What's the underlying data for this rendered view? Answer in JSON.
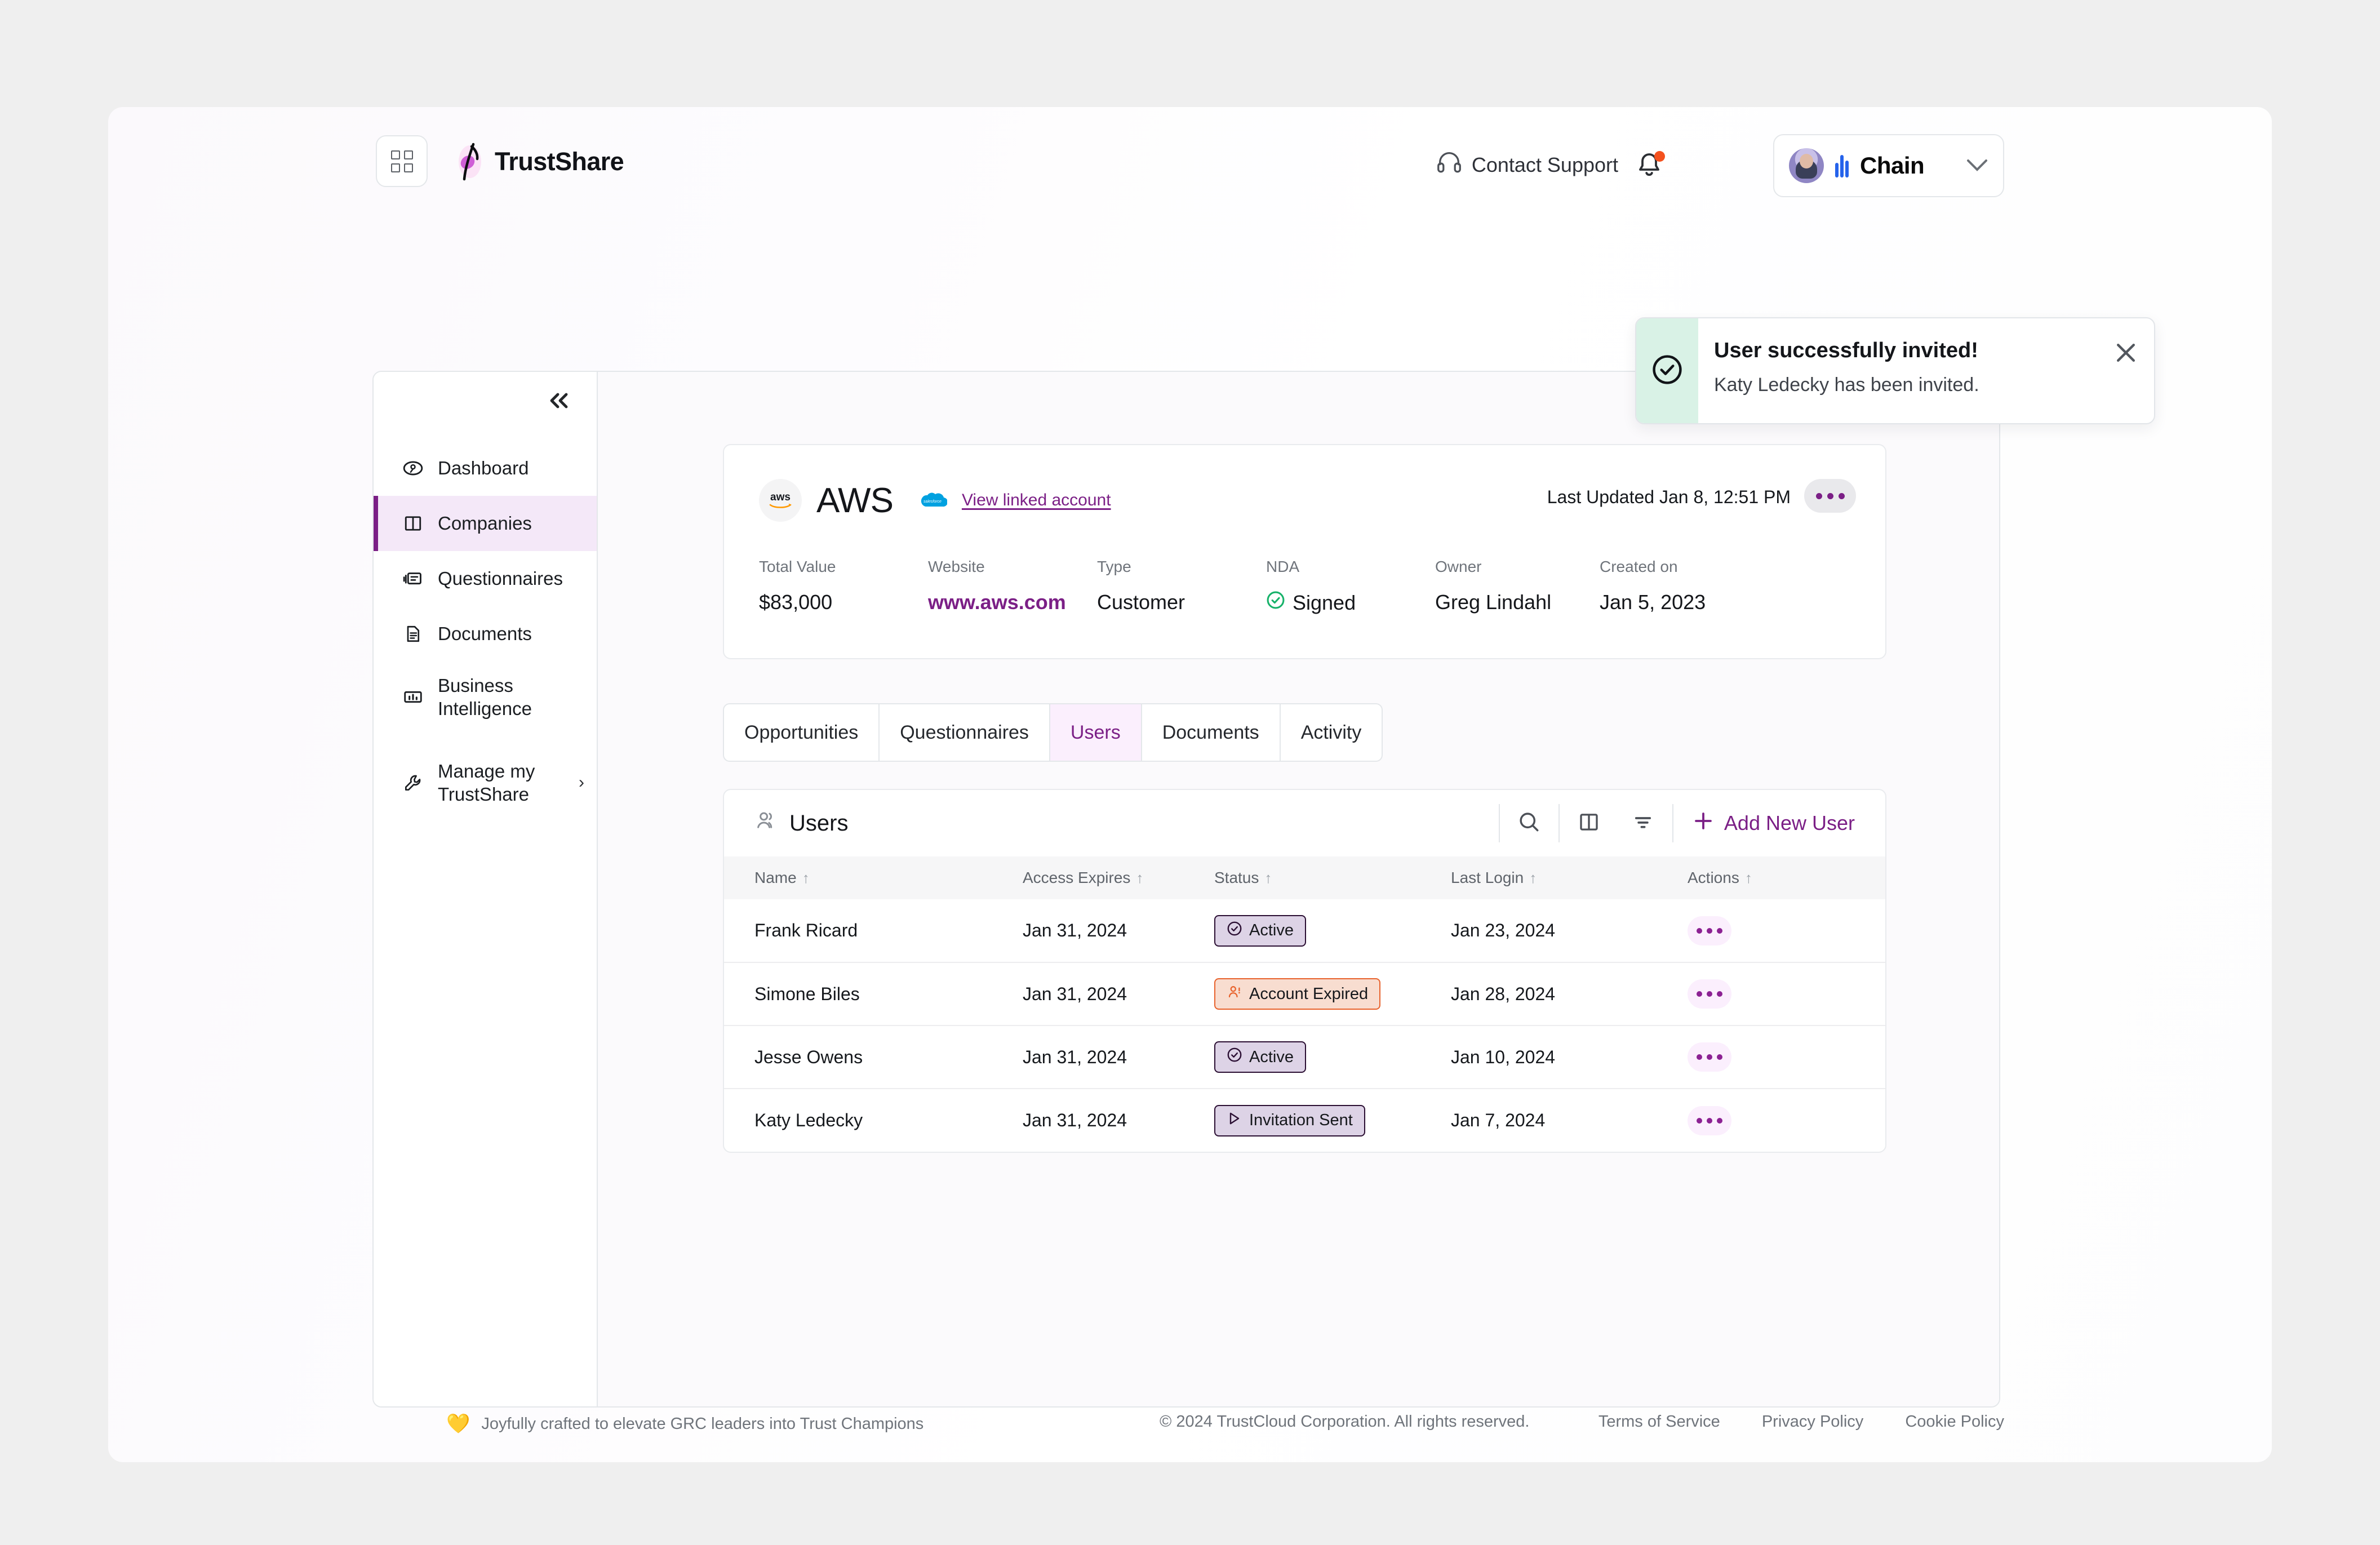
{
  "header": {
    "grid_icon": "grid-apps-icon",
    "brand_name": "TrustShare",
    "contact_support": "Contact Support",
    "support_icon": "headset-icon",
    "bell_icon": "bell-notification-icon",
    "account": {
      "org_name": "Chain",
      "avatar_icon": "user-avatar",
      "chevron": "⌄"
    }
  },
  "toast": {
    "status_icon": "check-circle-icon",
    "title": "User successfully invited!",
    "message": "Katy Ledecky has been invited.",
    "close_icon": "close-icon",
    "strip_color": "#d9f2e6"
  },
  "sidebar": {
    "collapse_icon": "«",
    "items": [
      {
        "label": "Dashboard",
        "icon": "dashboard-icon",
        "active": false
      },
      {
        "label": "Companies",
        "icon": "companies-icon",
        "active": true
      },
      {
        "label": "Questionnaires",
        "icon": "questionnaires-icon",
        "active": false
      },
      {
        "label": "Documents",
        "icon": "documents-icon",
        "active": false
      },
      {
        "label": "Business",
        "label2": "Intelligence",
        "icon": "business-intelligence-icon",
        "active": false
      },
      {
        "label": "Manage my",
        "label2": "TrustShare",
        "icon": "wrench-icon",
        "active": false,
        "arrow": "›"
      }
    ]
  },
  "company": {
    "logo_text": "aws",
    "name": "AWS",
    "salesforce_icon": "salesforce-cloud-icon",
    "linked_account_link": "View linked account",
    "last_updated": "Last Updated Jan 8, 12:51 PM",
    "more_icon": "more-options-icon",
    "facts": [
      {
        "label": "Total Value",
        "value": "$83,000",
        "style": "plain"
      },
      {
        "label": "Website",
        "value": "www.aws.com",
        "style": "link"
      },
      {
        "label": "Type",
        "value": "Customer",
        "style": "plain"
      },
      {
        "label": "NDA",
        "value": "Signed",
        "style": "check"
      },
      {
        "label": "Owner",
        "value": "Greg Lindahl",
        "style": "plain"
      },
      {
        "label": "Created on",
        "value": "Jan 5, 2023",
        "style": "plain"
      }
    ]
  },
  "tabs": [
    {
      "label": "Opportunities",
      "active": false
    },
    {
      "label": "Questionnaires",
      "active": false
    },
    {
      "label": "Users",
      "active": true
    },
    {
      "label": "Documents",
      "active": false
    },
    {
      "label": "Activity",
      "active": false
    }
  ],
  "users_panel": {
    "title": "Users",
    "title_icon": "users-icon",
    "search_icon": "search-icon",
    "columns_icon": "columns-layout-icon",
    "filter_icon": "filter-icon",
    "add_button": "Add New User",
    "add_icon": "plus-icon",
    "columns": [
      {
        "label": "Name",
        "sort": "↑"
      },
      {
        "label": "Access Expires",
        "sort": "↑"
      },
      {
        "label": "Status",
        "sort": "↑"
      },
      {
        "label": "Last Login",
        "sort": "↑"
      },
      {
        "label": "Actions",
        "sort": "↑"
      }
    ],
    "rows": [
      {
        "name": "Frank Ricard",
        "expires": "Jan 31, 2024",
        "status": "Active",
        "status_kind": "purple",
        "status_icon": "check-circle-icon",
        "last_login": "Jan 23, 2024"
      },
      {
        "name": "Simone Biles",
        "expires": "Jan 31, 2024",
        "status": "Account Expired",
        "status_kind": "orange",
        "status_icon": "user-alert-icon",
        "last_login": "Jan 28, 2024"
      },
      {
        "name": "Jesse Owens",
        "expires": "Jan 31, 2024",
        "status": "Active",
        "status_kind": "purple",
        "status_icon": "check-circle-icon",
        "last_login": "Jan 10, 2024"
      },
      {
        "name": "Katy Ledecky",
        "expires": "Jan 31, 2024",
        "status": "Invitation Sent",
        "status_kind": "purple",
        "status_icon": "send-icon",
        "last_login": "Jan 7, 2024"
      }
    ]
  },
  "footer": {
    "heart_icon": "💛",
    "tagline": "Joyfully crafted to elevate GRC leaders into Trust Champions",
    "copyright": "© 2024 TrustCloud Corporation. All rights reserved.",
    "links": [
      "Terms of Service",
      "Privacy Policy",
      "Cookie Policy"
    ]
  },
  "colors": {
    "accent_purple": "#7b1f86",
    "active_nav_bg": "#f4e8f8",
    "success_green": "#17b26a",
    "warning_orange": "#e8622c"
  }
}
